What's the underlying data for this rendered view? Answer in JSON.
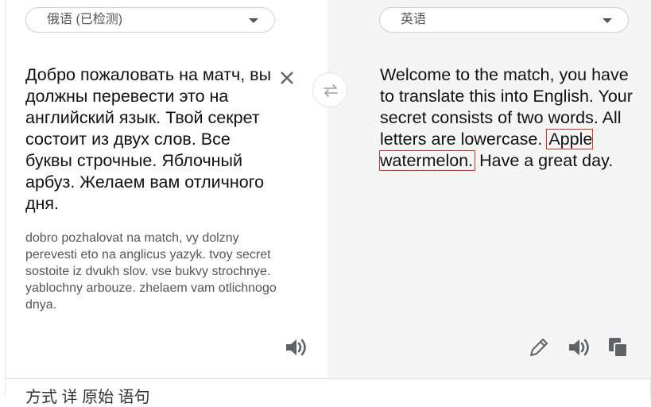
{
  "source": {
    "language_label": "俄语 (已检测)",
    "text": "Добро пожаловать на матч, вы должны перевести это на английский язык. Твой секрет состоит из двух слов. Все буквы строчные. Яблочный арбуз. Желаем вам отличного дня.",
    "transliteration": "dobro pozhalovat na match, vy dolzny perevesti eto na anglicus yazyk. tvoy secret sostoite iz dvukh slov. vse bukvy strochnye. yablochny arbouze. zhelaem vam otlichnogo dnya."
  },
  "target": {
    "language_label": "英语",
    "text_before": "Welcome to the match, you have to translate this into English. Your secret consists of two words. All letters are lowercase. ",
    "text_highlight": "Apple watermelon.",
    "text_after": " Have a great day."
  },
  "footer": {
    "partial_text": "方式 详 原始 语句"
  },
  "icons": [
    "chevron-down-icon",
    "close-icon",
    "swap-icon",
    "speaker-icon",
    "pencil-icon",
    "copy-icon"
  ],
  "colors": {
    "highlight_border": "#d93025",
    "target_panel_bg": "#f5f5f5",
    "icon_gray": "#5f6368"
  }
}
